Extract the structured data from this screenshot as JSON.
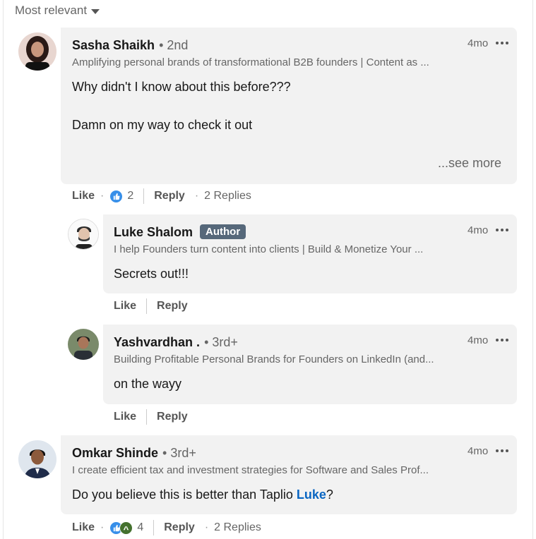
{
  "sort": {
    "label": "Most relevant"
  },
  "comments": [
    {
      "name": "Sasha Shaikh",
      "degree": "• 2nd",
      "headline": "Amplifying personal brands of transformational B2B founders | Content as ...",
      "time": "4mo",
      "text_lines": [
        "Why didn't I know about this before???",
        "Damn on my way to check it out"
      ],
      "see_more": "...see more",
      "actions": {
        "like": "Like",
        "reaction_count": "2",
        "reply": "Reply",
        "replies": "2 Replies"
      }
    },
    {
      "name": "Luke Shalom",
      "badge": "Author",
      "headline": "I help Founders turn content into clients | Build & Monetize Your ...",
      "time": "4mo",
      "text": "Secrets out!!!",
      "actions": {
        "like": "Like",
        "reply": "Reply"
      }
    },
    {
      "name": "Yashvardhan .",
      "degree": "• 3rd+",
      "headline": "Building Profitable Personal Brands for Founders on LinkedIn (and...",
      "time": "4mo",
      "text": "on the wayy",
      "actions": {
        "like": "Like",
        "reply": "Reply"
      }
    },
    {
      "name": "Omkar Shinde",
      "degree": "• 3rd+",
      "headline": "I create efficient tax and investment strategies for Software and Sales Prof...",
      "time": "4mo",
      "text_prefix": "Do you believe this is better than Taplio ",
      "mention": "Luke",
      "text_suffix": "?",
      "actions": {
        "like": "Like",
        "reaction_count": "4",
        "reply": "Reply",
        "replies": "2 Replies"
      }
    }
  ],
  "icons": {
    "like": "thumbs-up-icon",
    "support": "support-hands-icon",
    "overflow": "overflow-dots-icon"
  },
  "colors": {
    "accent": "#0a66c2",
    "like_blue": "#378fe9",
    "support_green": "#44712e",
    "author_badge": "#56687a",
    "bubble": "#f2f2f2"
  }
}
